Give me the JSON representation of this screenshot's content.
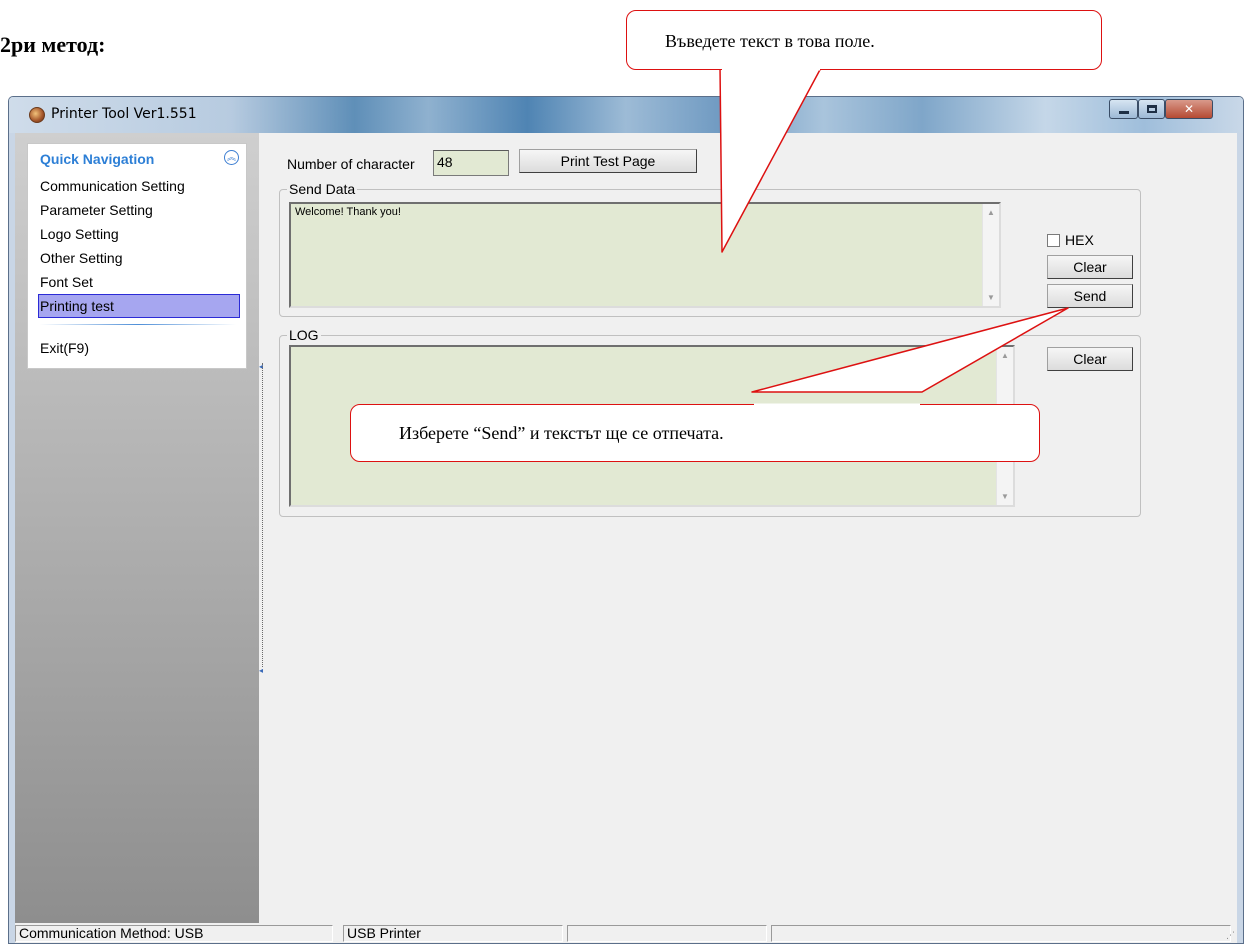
{
  "document": {
    "heading": "2ри метод:"
  },
  "window": {
    "title": "Printer Tool Ver1.551"
  },
  "sidebar": {
    "header": "Quick Navigation",
    "items": [
      {
        "label": "Communication Setting",
        "selected": false
      },
      {
        "label": "Parameter Setting",
        "selected": false
      },
      {
        "label": "Logo Setting",
        "selected": false
      },
      {
        "label": "Other Setting",
        "selected": false
      },
      {
        "label": "Font Set",
        "selected": false
      },
      {
        "label": "Printing test",
        "selected": true
      }
    ],
    "exit_label": "Exit(F9)"
  },
  "main": {
    "char_count_label": "Number of character",
    "char_count_value": "48",
    "print_test_button": "Print Test Page",
    "send_group": {
      "title": "Send Data",
      "text": "Welcome! Thank you!",
      "hex_label": "HEX",
      "hex_checked": false,
      "clear_button": "Clear",
      "send_button": "Send"
    },
    "log_group": {
      "title": "LOG",
      "clear_button": "Clear"
    }
  },
  "status_bar": {
    "cells": [
      "Communication Method: USB",
      "USB Printer",
      "",
      ""
    ]
  },
  "callouts": {
    "enter_text": "Въведете текст в това поле.",
    "send_hint": "Изберете “Send” и текстът ще се отпечата."
  },
  "colors": {
    "field_background": "#e2e9d3",
    "selection": "#a6a6f0",
    "callout_border": "#dd1111",
    "nav_header": "#2d7fd6"
  }
}
